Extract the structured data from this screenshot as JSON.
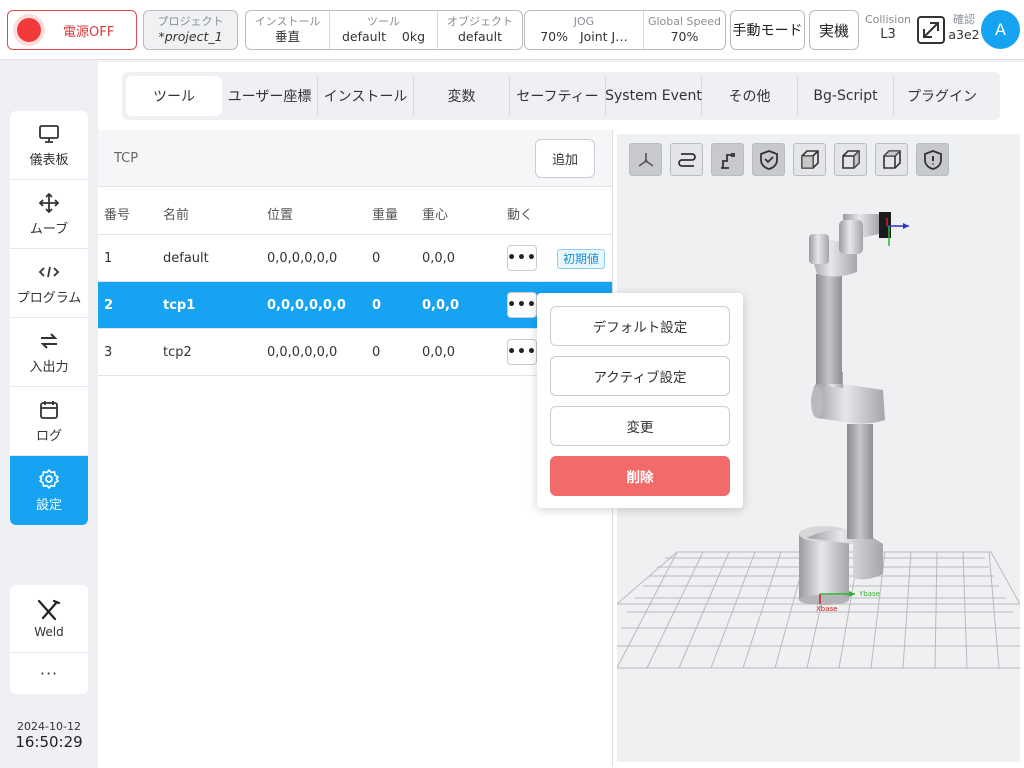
{
  "topbar": {
    "power_label": "電源OFF",
    "project_caption": "プロジェクト",
    "project_value": "*project_1",
    "install_caption": "インストール",
    "install_value": "垂直",
    "tool_caption": "ツール",
    "tool_value": "default",
    "tool_weight": "0kg",
    "object_caption": "オブジェクト",
    "object_value": "default",
    "jog_caption": "JOG",
    "jog_percent": "70%",
    "jog_mode": "Joint J…",
    "speed_caption": "Global Speed",
    "speed_value": "70%",
    "manual_mode_label": "手動モード",
    "real_label": "実機",
    "collision_caption": "Collision",
    "collision_value": "L3",
    "confirm_caption": "確認",
    "confirm_value": "a3e2",
    "avatar_letter": "A"
  },
  "sidebar": {
    "items": [
      {
        "label": "儀表板",
        "icon": "monitor-icon"
      },
      {
        "label": "ムーブ",
        "icon": "move-icon"
      },
      {
        "label": "プログラム",
        "icon": "code-icon"
      },
      {
        "label": "入出力",
        "icon": "io-icon"
      },
      {
        "label": "ログ",
        "icon": "calendar-icon"
      },
      {
        "label": "設定",
        "icon": "gear-icon"
      }
    ],
    "weld_label": "Weld",
    "more_label": "···",
    "date": "2024-10-12",
    "time": "16:50:29"
  },
  "tabs": [
    "ツール",
    "ユーザー座標",
    "インストール",
    "変数",
    "セーフティー",
    "System Event",
    "その他",
    "Bg-Script",
    "プラグイン"
  ],
  "panel": {
    "title": "TCP",
    "add_label": "追加",
    "columns": [
      "番号",
      "名前",
      "位置",
      "重量",
      "重心",
      "動く"
    ],
    "rows": [
      {
        "no": "1",
        "name": "default",
        "pos": "0,0,0,0,0,0",
        "weight": "0",
        "cog": "0,0,0",
        "badge": "初期値"
      },
      {
        "no": "2",
        "name": "tcp1",
        "pos": "0,0,0,0,0,0",
        "weight": "0",
        "cog": "0,0,0"
      },
      {
        "no": "3",
        "name": "tcp2",
        "pos": "0,0,0,0,0,0",
        "weight": "0",
        "cog": "0,0,0"
      }
    ],
    "row_menu_label": "•••"
  },
  "menu": {
    "default_label": "デフォルト設定",
    "active_label": "アクティブ設定",
    "edit_label": "変更",
    "delete_label": "削除"
  },
  "view3d": {
    "toolbar_icons": [
      "axis-icon",
      "path-icon",
      "robot-icon",
      "shield-check-icon",
      "cube-front-icon",
      "cube-side-icon",
      "cube-top-icon",
      "shield-alert-icon"
    ],
    "axis_x_label": "Xbase",
    "axis_y_label": "Ybase"
  },
  "colors": {
    "accent": "#16a3f2",
    "danger": "#f26b6b",
    "power": "#f23a3a"
  }
}
